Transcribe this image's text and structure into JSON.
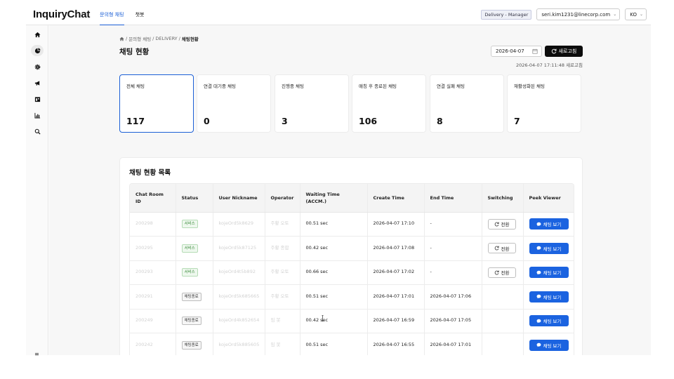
{
  "header": {
    "logo": "InquiryChat",
    "tabs": [
      {
        "label": "문의형 채팅",
        "active": true
      },
      {
        "label": "챗봇",
        "active": false
      }
    ],
    "role_badge": "Delivery - Manager",
    "user_email": "seri.kim1231@linecorp.com",
    "language": "KO"
  },
  "sidebar": {
    "icons": [
      "home-icon",
      "pie-chart-icon",
      "settings-icon",
      "megaphone-icon",
      "calendar-icon",
      "bar-chart-icon",
      "search-icon"
    ],
    "active_index": 1
  },
  "breadcrumb": {
    "items": [
      "문의형 채팅",
      "DELIVERY"
    ],
    "current": "채팅현황"
  },
  "page": {
    "title": "채팅 현황",
    "date": "2026-04-07",
    "refresh_label": "새로고침",
    "last_updated": "2026-04-07 17:11:48 새로고침"
  },
  "stats": [
    {
      "label": "전체 채팅",
      "value": "117",
      "selected": true
    },
    {
      "label": "연결 대기중 채팅",
      "value": "0",
      "selected": false
    },
    {
      "label": "진행중 채팅",
      "value": "3",
      "selected": false
    },
    {
      "label": "매칭 후 종료된 채팅",
      "value": "106",
      "selected": false
    },
    {
      "label": "연결 실패 채팅",
      "value": "8",
      "selected": false
    },
    {
      "label": "재활성화된 채팅",
      "value": "7",
      "selected": false
    }
  ],
  "table": {
    "title": "채팅 현황 목록",
    "columns": {
      "room_id": "Chat Room ID",
      "status": "Status",
      "nickname": "User Nickname",
      "operator": "Operator",
      "waiting": "Waiting Time (ACCM.)",
      "create": "Create Time",
      "end": "End Time",
      "switching": "Switching",
      "peek": "Peek Viewer"
    },
    "switch_label": "전환",
    "peek_label": "채팅 보기",
    "rows": [
      {
        "room_id": "200298",
        "status": "서비스",
        "status_type": "service",
        "nickname": "kojeOrd5k8629",
        "operator": "주황 오토",
        "waiting": "00.51 sec",
        "create": "2026-04-07 17:10",
        "end": "-",
        "switch": true
      },
      {
        "room_id": "200295",
        "status": "서비스",
        "status_type": "service",
        "nickname": "kojeOrd5k87125",
        "operator": "주황 종합",
        "waiting": "00.42 sec",
        "create": "2026-04-07 17:08",
        "end": "-",
        "switch": true
      },
      {
        "room_id": "200293",
        "status": "서비스",
        "status_type": "service",
        "nickname": "kojeOrd4t5b892",
        "operator": "주황 오토",
        "waiting": "00.66 sec",
        "create": "2026-04-07 17:02",
        "end": "-",
        "switch": true
      },
      {
        "room_id": "200291",
        "status": "채팅종료",
        "status_type": "ended",
        "nickname": "kojeOrd5k685665",
        "operator": "주황 오토",
        "waiting": "00.51 sec",
        "create": "2026-04-07 17:01",
        "end": "2026-04-07 17:06",
        "switch": false
      },
      {
        "room_id": "200249",
        "status": "채팅종료",
        "status_type": "ended",
        "nickname": "kojeOrd4k852654",
        "operator": "임 봇",
        "waiting": "00.42 sec",
        "create": "2026-04-07 16:59",
        "end": "2026-04-07 17:05",
        "switch": false
      },
      {
        "room_id": "200242",
        "status": "채팅종료",
        "status_type": "ended",
        "nickname": "kojeOrd5k885605",
        "operator": "임 봇",
        "waiting": "00.51 sec",
        "create": "2026-04-07 16:55",
        "end": "2026-04-07 17:01",
        "switch": false
      }
    ]
  },
  "colors": {
    "accent": "#1b5fd6",
    "peek_button": "#1b63e0",
    "refresh_button": "#0c0c0c",
    "service_badge": "#3a8a3a"
  }
}
